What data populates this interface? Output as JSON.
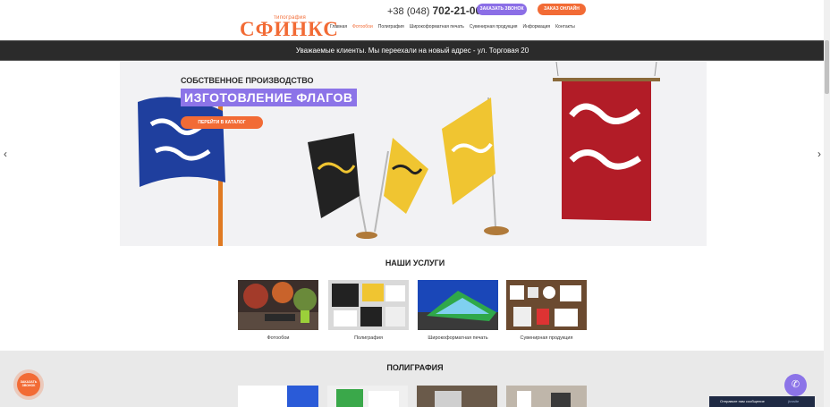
{
  "header": {
    "logo_subtitle": "типография",
    "logo_text": "СФИНКС",
    "phone_prefix": "+38 (048)",
    "phone_number": "702-21-00",
    "call_button": "ЗАКАЗАТЬ ЗВОНОК",
    "order_button": "ЗАКАЗ ОНЛАЙН",
    "nav": [
      {
        "label": "Главная",
        "active": false
      },
      {
        "label": "Фотообои",
        "active": true
      },
      {
        "label": "Полиграфия",
        "active": false
      },
      {
        "label": "Широкоформатная печать",
        "active": false
      },
      {
        "label": "Сувенирная продукция",
        "active": false
      },
      {
        "label": "Информация",
        "active": false
      },
      {
        "label": "Контакты",
        "active": false
      }
    ]
  },
  "notice": {
    "text": "Уважаемые клиенты. Мы переехали на новый адрес - ул. Торговая 20"
  },
  "hero": {
    "kicker": "СОБСТВЕННОЕ ПРОИЗВОДСТВО",
    "title": "ИЗГОТОВЛЕНИЕ ФЛАГОВ",
    "button": "ПЕРЕЙТИ В КАТАЛОГ",
    "prev_icon": "chevron-left-icon",
    "next_icon": "chevron-right-icon"
  },
  "services": {
    "title": "НАШИ УСЛУГИ",
    "items": [
      {
        "label": "Фотообои"
      },
      {
        "label": "Полиграфия"
      },
      {
        "label": "Широкоформатная печать"
      },
      {
        "label": "Сувенирная продукция"
      }
    ]
  },
  "polygraphy": {
    "title": "ПОЛИГРАФИЯ"
  },
  "widgets": {
    "callback_text_line1": "ЗАКАЗАТЬ",
    "callback_text_line2": "ЗВОНОК",
    "phone_icon": "phone-icon",
    "chat_text": "Отправьте нам сообщение",
    "chat_brand": "jivosite"
  },
  "colors": {
    "accent_orange": "#f26b35",
    "accent_purple": "#8c74e8",
    "notice_bg": "#2b2b2b"
  }
}
